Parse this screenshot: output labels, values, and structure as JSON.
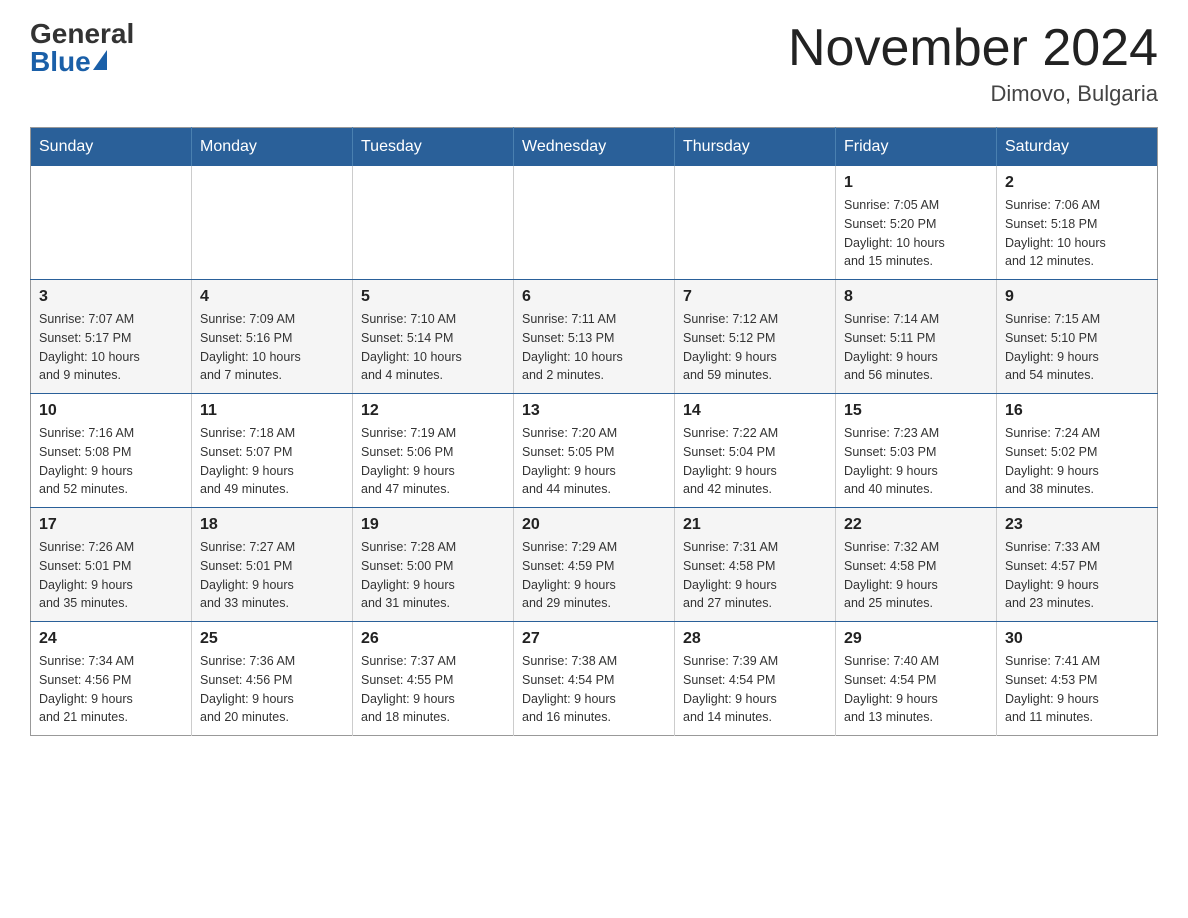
{
  "header": {
    "logo_general": "General",
    "logo_blue": "Blue",
    "month_title": "November 2024",
    "location": "Dimovo, Bulgaria"
  },
  "weekdays": [
    "Sunday",
    "Monday",
    "Tuesday",
    "Wednesday",
    "Thursday",
    "Friday",
    "Saturday"
  ],
  "weeks": [
    [
      {
        "day": "",
        "info": ""
      },
      {
        "day": "",
        "info": ""
      },
      {
        "day": "",
        "info": ""
      },
      {
        "day": "",
        "info": ""
      },
      {
        "day": "",
        "info": ""
      },
      {
        "day": "1",
        "info": "Sunrise: 7:05 AM\nSunset: 5:20 PM\nDaylight: 10 hours\nand 15 minutes."
      },
      {
        "day": "2",
        "info": "Sunrise: 7:06 AM\nSunset: 5:18 PM\nDaylight: 10 hours\nand 12 minutes."
      }
    ],
    [
      {
        "day": "3",
        "info": "Sunrise: 7:07 AM\nSunset: 5:17 PM\nDaylight: 10 hours\nand 9 minutes."
      },
      {
        "day": "4",
        "info": "Sunrise: 7:09 AM\nSunset: 5:16 PM\nDaylight: 10 hours\nand 7 minutes."
      },
      {
        "day": "5",
        "info": "Sunrise: 7:10 AM\nSunset: 5:14 PM\nDaylight: 10 hours\nand 4 minutes."
      },
      {
        "day": "6",
        "info": "Sunrise: 7:11 AM\nSunset: 5:13 PM\nDaylight: 10 hours\nand 2 minutes."
      },
      {
        "day": "7",
        "info": "Sunrise: 7:12 AM\nSunset: 5:12 PM\nDaylight: 9 hours\nand 59 minutes."
      },
      {
        "day": "8",
        "info": "Sunrise: 7:14 AM\nSunset: 5:11 PM\nDaylight: 9 hours\nand 56 minutes."
      },
      {
        "day": "9",
        "info": "Sunrise: 7:15 AM\nSunset: 5:10 PM\nDaylight: 9 hours\nand 54 minutes."
      }
    ],
    [
      {
        "day": "10",
        "info": "Sunrise: 7:16 AM\nSunset: 5:08 PM\nDaylight: 9 hours\nand 52 minutes."
      },
      {
        "day": "11",
        "info": "Sunrise: 7:18 AM\nSunset: 5:07 PM\nDaylight: 9 hours\nand 49 minutes."
      },
      {
        "day": "12",
        "info": "Sunrise: 7:19 AM\nSunset: 5:06 PM\nDaylight: 9 hours\nand 47 minutes."
      },
      {
        "day": "13",
        "info": "Sunrise: 7:20 AM\nSunset: 5:05 PM\nDaylight: 9 hours\nand 44 minutes."
      },
      {
        "day": "14",
        "info": "Sunrise: 7:22 AM\nSunset: 5:04 PM\nDaylight: 9 hours\nand 42 minutes."
      },
      {
        "day": "15",
        "info": "Sunrise: 7:23 AM\nSunset: 5:03 PM\nDaylight: 9 hours\nand 40 minutes."
      },
      {
        "day": "16",
        "info": "Sunrise: 7:24 AM\nSunset: 5:02 PM\nDaylight: 9 hours\nand 38 minutes."
      }
    ],
    [
      {
        "day": "17",
        "info": "Sunrise: 7:26 AM\nSunset: 5:01 PM\nDaylight: 9 hours\nand 35 minutes."
      },
      {
        "day": "18",
        "info": "Sunrise: 7:27 AM\nSunset: 5:01 PM\nDaylight: 9 hours\nand 33 minutes."
      },
      {
        "day": "19",
        "info": "Sunrise: 7:28 AM\nSunset: 5:00 PM\nDaylight: 9 hours\nand 31 minutes."
      },
      {
        "day": "20",
        "info": "Sunrise: 7:29 AM\nSunset: 4:59 PM\nDaylight: 9 hours\nand 29 minutes."
      },
      {
        "day": "21",
        "info": "Sunrise: 7:31 AM\nSunset: 4:58 PM\nDaylight: 9 hours\nand 27 minutes."
      },
      {
        "day": "22",
        "info": "Sunrise: 7:32 AM\nSunset: 4:58 PM\nDaylight: 9 hours\nand 25 minutes."
      },
      {
        "day": "23",
        "info": "Sunrise: 7:33 AM\nSunset: 4:57 PM\nDaylight: 9 hours\nand 23 minutes."
      }
    ],
    [
      {
        "day": "24",
        "info": "Sunrise: 7:34 AM\nSunset: 4:56 PM\nDaylight: 9 hours\nand 21 minutes."
      },
      {
        "day": "25",
        "info": "Sunrise: 7:36 AM\nSunset: 4:56 PM\nDaylight: 9 hours\nand 20 minutes."
      },
      {
        "day": "26",
        "info": "Sunrise: 7:37 AM\nSunset: 4:55 PM\nDaylight: 9 hours\nand 18 minutes."
      },
      {
        "day": "27",
        "info": "Sunrise: 7:38 AM\nSunset: 4:54 PM\nDaylight: 9 hours\nand 16 minutes."
      },
      {
        "day": "28",
        "info": "Sunrise: 7:39 AM\nSunset: 4:54 PM\nDaylight: 9 hours\nand 14 minutes."
      },
      {
        "day": "29",
        "info": "Sunrise: 7:40 AM\nSunset: 4:54 PM\nDaylight: 9 hours\nand 13 minutes."
      },
      {
        "day": "30",
        "info": "Sunrise: 7:41 AM\nSunset: 4:53 PM\nDaylight: 9 hours\nand 11 minutes."
      }
    ]
  ]
}
